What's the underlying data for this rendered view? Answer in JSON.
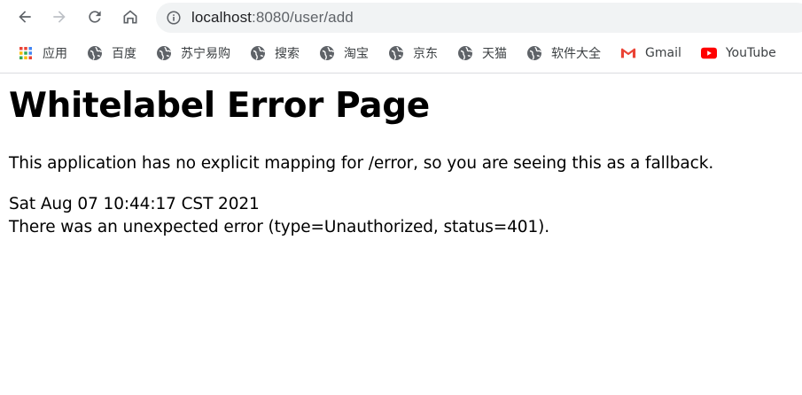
{
  "browser": {
    "url_host": "localhost",
    "url_rest": ":8080/user/add"
  },
  "bookmarks": [
    {
      "label": "应用",
      "icon": "apps-grid-icon"
    },
    {
      "label": "百度",
      "icon": "globe-icon"
    },
    {
      "label": "苏宁易购",
      "icon": "globe-icon"
    },
    {
      "label": "搜索",
      "icon": "globe-icon"
    },
    {
      "label": "淘宝",
      "icon": "globe-icon"
    },
    {
      "label": "京东",
      "icon": "globe-icon"
    },
    {
      "label": "天猫",
      "icon": "globe-icon"
    },
    {
      "label": "软件大全",
      "icon": "globe-icon"
    },
    {
      "label": "Gmail",
      "icon": "gmail-icon"
    },
    {
      "label": "YouTube",
      "icon": "youtube-icon"
    }
  ],
  "page": {
    "title": "Whitelabel Error Page",
    "message": "This application has no explicit mapping for /error, so you are seeing this as a fallback.",
    "timestamp": "Sat Aug 07 10:44:17 CST 2021",
    "error": "There was an unexpected error (type=Unauthorized, status=401)."
  },
  "colors": {
    "toolbar_icon": "#5f6368",
    "forward_disabled": "#bdc1c6",
    "omnibox_bg": "#f1f3f4",
    "gmail_red": "#ea4335",
    "youtube_red": "#ff0000"
  }
}
